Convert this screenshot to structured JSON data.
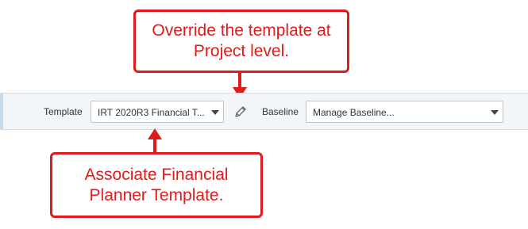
{
  "toolbar": {
    "template_label": "Template",
    "template_value": "IRT 2020R3 Financial T...",
    "baseline_label": "Baseline",
    "baseline_value": "Manage Baseline..."
  },
  "callouts": {
    "top_text": "Override the template at Project level.",
    "bottom_text": "Associate Financial Planner Template."
  },
  "colors": {
    "callout_red": "#e01b1b",
    "toolbar_bg": "#f3f6f9"
  },
  "icons": {
    "edit": "pencil-icon",
    "dropdown": "chevron-down-icon"
  }
}
